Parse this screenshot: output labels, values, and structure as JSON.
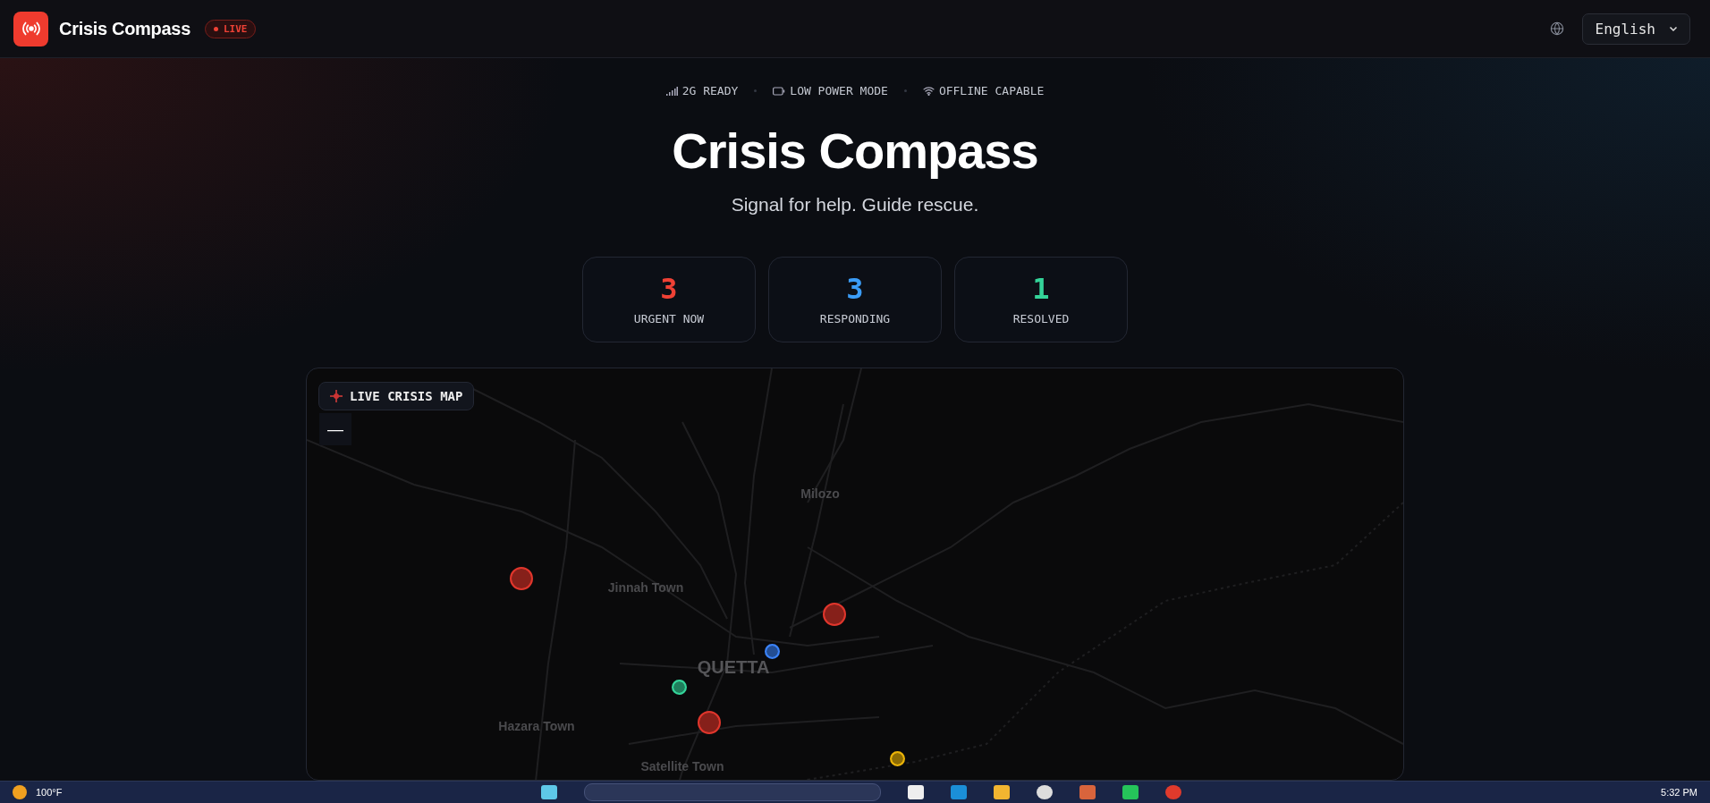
{
  "header": {
    "app_name": "Crisis Compass",
    "live_badge": "LIVE",
    "language_select": {
      "value": "English"
    }
  },
  "status_strip": [
    {
      "kind": "signal",
      "label": "2G READY"
    },
    {
      "kind": "battery",
      "label": "LOW POWER MODE"
    },
    {
      "kind": "wifi",
      "label": "OFFLINE CAPABLE"
    }
  ],
  "hero": {
    "title": "Crisis Compass",
    "subtitle": "Signal for help. Guide rescue."
  },
  "stats": [
    {
      "value": "3",
      "label": "URGENT NOW",
      "color": "#ef4135"
    },
    {
      "value": "3",
      "label": "RESPONDING",
      "color": "#3b9cf6"
    },
    {
      "value": "1",
      "label": "RESOLVED",
      "color": "#34d399"
    }
  ],
  "map": {
    "title": "LIVE CRISIS MAP",
    "zoom_out": "—",
    "places": [
      {
        "kind": "town",
        "name": "Milozo"
      },
      {
        "kind": "town",
        "name": "Jinnah Town"
      },
      {
        "kind": "city",
        "name": "QUETTA"
      },
      {
        "kind": "town",
        "name": "Hazara Town"
      },
      {
        "kind": "town",
        "name": "Satellite Town"
      }
    ],
    "markers": [
      {
        "kind": "large",
        "color": "#e0362c"
      },
      {
        "kind": "large",
        "color": "#e0362c"
      },
      {
        "kind": "small",
        "color": "#3b82f6"
      },
      {
        "kind": "small",
        "color": "#34d399"
      },
      {
        "kind": "large",
        "color": "#e0362c"
      },
      {
        "kind": "small",
        "color": "#eab308"
      }
    ]
  },
  "taskbar": {
    "weather": "100°F",
    "clock": "5:32 PM"
  }
}
